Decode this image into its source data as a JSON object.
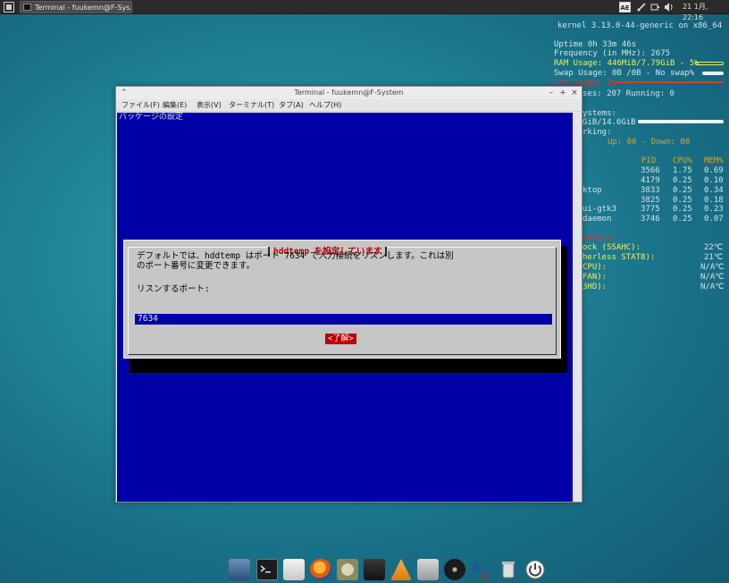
{
  "top_panel": {
    "task_title": "Terminal - fuukemn@F-Sys...",
    "keyboard_indicator": "AE",
    "clock": "21 1月, 22:16"
  },
  "conky": {
    "kernel": "kernel 3.13.0-44-generic on x86_64",
    "uptime": "Uptime  0h 33m 46s",
    "frequency": "Frequency (in MHz): 2675",
    "ram": "RAM Usage: 446MiB/7.79GiB - 5%",
    "swap": "Swap Usage: 0B  /0B    - No swap%",
    "cpu": "CPU Usage: 2%",
    "processes": "ses: 207  Running: 0",
    "disk_header": "ystems:",
    "disk": "GiB/14.6GiB",
    "network_label": "rking:",
    "network": "Up: 00     - Down: 00",
    "proc_headers": [
      "PID",
      "CPU%",
      "MEM%"
    ],
    "processes_list": [
      {
        "name": "",
        "pid": "3566",
        "cpu": "1.75",
        "mem": "0.69"
      },
      {
        "name": "",
        "pid": "4179",
        "cpu": "0.25",
        "mem": "0.10"
      },
      {
        "name": "ktop",
        "pid": "3833",
        "cpu": "0.25",
        "mem": "0.34"
      },
      {
        "name": "",
        "pid": "3825",
        "cpu": "0.25",
        "mem": "0.18"
      },
      {
        "name": "ui-gtk3",
        "pid": "3775",
        "cpu": "0.25",
        "mem": "0.23"
      },
      {
        "name": "daemon",
        "pid": "3746",
        "cpu": "0.25",
        "mem": "0.07"
      }
    ],
    "temps": [
      {
        "label": "rature",
        "value": ""
      },
      {
        "label": "ock (SSAHC):",
        "value": "22℃"
      },
      {
        "label": "herless STAT8):",
        "value": "21℃"
      },
      {
        "label": "CPU):",
        "value": "N/A℃"
      },
      {
        "label": "FAN):",
        "value": "N/A℃"
      },
      {
        "label": "3HD):",
        "value": "N/A℃"
      }
    ]
  },
  "terminal": {
    "title": "Terminal - fuukemn@F-System",
    "menu": [
      "ファイル(F)",
      "編集(E)",
      "表示(V)",
      "ターミナル(T)",
      "タブ(A)",
      "ヘルプ(H)"
    ],
    "backtitle": "パッケージの設定",
    "dialog": {
      "title": "hddtemp を設定しています",
      "line1": "デフォルトでは、hddtemp はポート 7634 で入力接続をリスンします。これは別",
      "line2": "のポート番号に変更できます。",
      "prompt": "リスンするポート:",
      "input_value": "7634",
      "ok_label": "<了解>"
    }
  },
  "dock": [
    "files-icon",
    "terminal-icon",
    "text-editor-icon",
    "firefox-icon",
    "image-viewer-icon",
    "media-player-icon",
    "audio-mixer-icon",
    "disc-icon",
    "font-icon",
    "trash-icon",
    "logout-icon"
  ],
  "colors": {
    "terminal_bg": "#0000a8",
    "dialog_bg": "#c6c6c6",
    "accent_red": "#b80000",
    "conky_yellow": "#f2ee5a"
  }
}
